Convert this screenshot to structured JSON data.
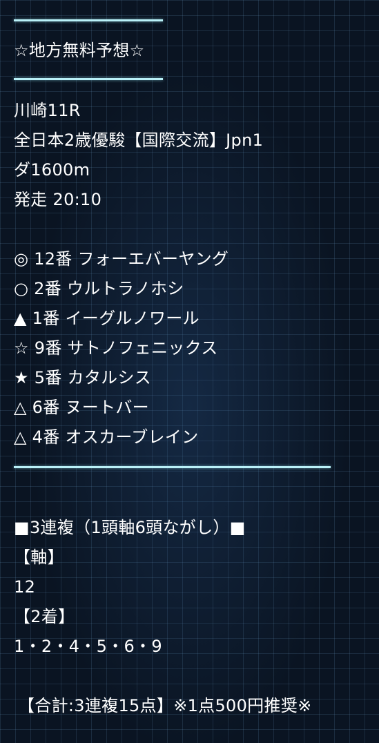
{
  "header": {
    "title": "☆地方無料予想☆"
  },
  "race": {
    "venue": "川崎11R",
    "name": "全日本2歳優駿【国際交流】Jpn1",
    "course": "ダ1600m",
    "start": "発走 20:10"
  },
  "picks": [
    "◎ 12番 フォーエバーヤング",
    "○ 2番 ウルトラノホシ",
    "▲ 1番 イーグルノワール",
    "☆ 9番 サトノフェニックス",
    "★ 5番 カタルシス",
    "△ 6番 ヌートバー",
    "△ 4番 オスカーブレイン"
  ],
  "bet": {
    "type": "■3連複（1頭軸6頭ながし）■",
    "axis_label": "【軸】",
    "axis_value": "12",
    "second_label": "【2着】",
    "second_value": "1・2・4・5・6・9",
    "total": "【合計:3連複15点】※1点500円推奨※"
  },
  "colors": {
    "rule": "#b9f0f7",
    "text": "#ffffff",
    "background": "#0a1422"
  }
}
